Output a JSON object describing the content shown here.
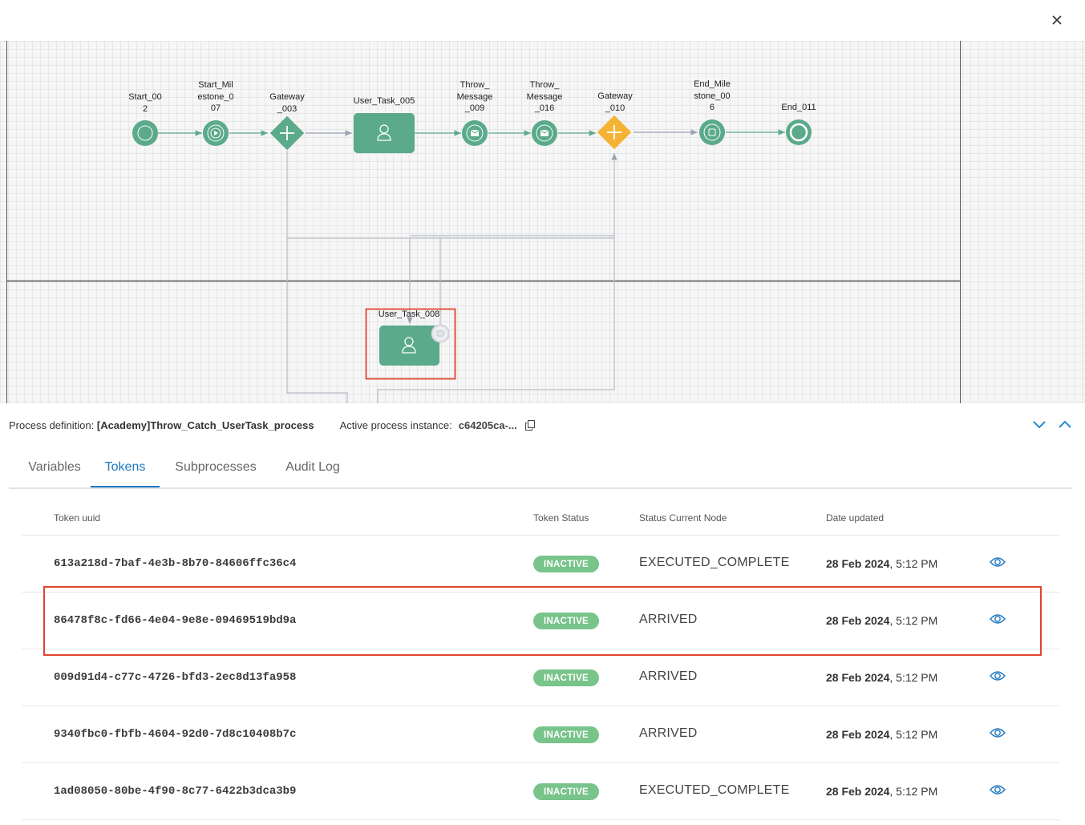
{
  "close_label": "×",
  "diagram": {
    "nodes": [
      {
        "id": "start",
        "label": "Start_00\n2",
        "type": "start-event"
      },
      {
        "id": "start_milestone",
        "label": "Start_Mil\nestone_0\n07",
        "type": "milestone-event"
      },
      {
        "id": "gateway_003",
        "label": "Gateway\n_003",
        "type": "parallel-gateway"
      },
      {
        "id": "user_task_005",
        "label": "User_Task_005",
        "type": "user-task"
      },
      {
        "id": "throw_009",
        "label": "Throw_\nMessage\n_009",
        "type": "message-throw-event"
      },
      {
        "id": "throw_016",
        "label": "Throw_\nMessage\n_016",
        "type": "message-throw-event"
      },
      {
        "id": "gateway_010",
        "label": "Gateway\n_010",
        "type": "parallel-gateway-active"
      },
      {
        "id": "end_milestone",
        "label": "End_Mile\nstone_00\n6",
        "type": "milestone-event"
      },
      {
        "id": "end_011",
        "label": "End_011",
        "type": "end-event"
      },
      {
        "id": "user_task_008",
        "label": "User_Task_008",
        "type": "user-task-selected"
      }
    ],
    "colors": {
      "node": "#5aaa8b",
      "active_gateway": "#f5b335",
      "highlight": "#e0452f",
      "flow": "#9aa3b0"
    }
  },
  "info": {
    "definition_label": "Process definition:",
    "definition_value": "[Academy]Throw_Catch_UserTask_process",
    "instance_label": "Active process instance:",
    "instance_value": "c64205ca-..."
  },
  "tabs": [
    {
      "label": "Variables",
      "active": false
    },
    {
      "label": "Tokens",
      "active": true
    },
    {
      "label": "Subprocesses",
      "active": false
    },
    {
      "label": "Audit Log",
      "active": false
    }
  ],
  "table": {
    "headers": {
      "uuid": "Token uuid",
      "status": "Token Status",
      "node": "Status Current Node",
      "date": "Date updated"
    },
    "rows": [
      {
        "uuid": "613a218d-7baf-4e3b-8b70-84606ffc36c4",
        "status": "INACTIVE",
        "node": "EXECUTED_COMPLETE",
        "date_bold": "28 Feb 2024",
        "time": ", 5:12 PM"
      },
      {
        "uuid": "86478f8c-fd66-4e04-9e8e-09469519bd9a",
        "status": "INACTIVE",
        "node": "ARRIVED",
        "date_bold": "28 Feb 2024",
        "time": ", 5:12 PM"
      },
      {
        "uuid": "009d91d4-c77c-4726-bfd3-2ec8d13fa958",
        "status": "INACTIVE",
        "node": "ARRIVED",
        "date_bold": "28 Feb 2024",
        "time": ", 5:12 PM"
      },
      {
        "uuid": "9340fbc0-fbfb-4604-92d0-7d8c10408b7c",
        "status": "INACTIVE",
        "node": "ARRIVED",
        "date_bold": "28 Feb 2024",
        "time": ", 5:12 PM"
      },
      {
        "uuid": "1ad08050-80be-4f90-8c77-6422b3dca3b9",
        "status": "INACTIVE",
        "node": "EXECUTED_COMPLETE",
        "date_bold": "28 Feb 2024",
        "time": ", 5:12 PM"
      }
    ]
  },
  "icons": {
    "close": "close-icon",
    "copy": "copy-icon",
    "collapse": "chevron-down-icon",
    "expand": "chevron-up-icon",
    "view": "eye-icon"
  }
}
